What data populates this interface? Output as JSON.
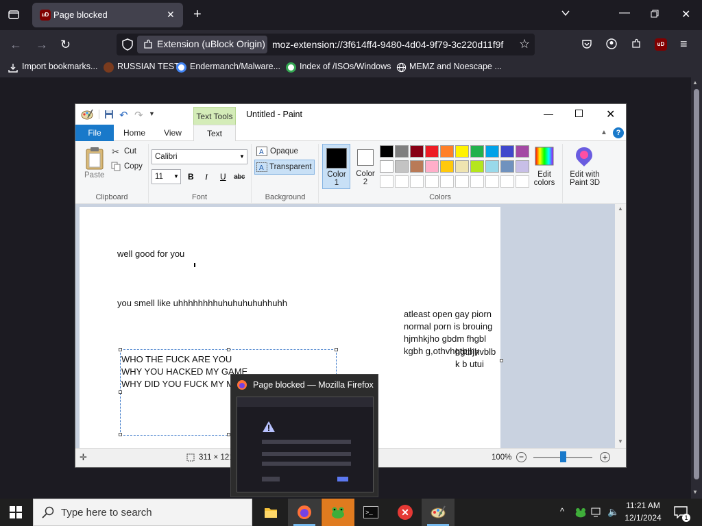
{
  "browser": {
    "tab_title": "Page blocked",
    "tab_favicon_text": "uD",
    "url_chip": "Extension (uBlock Origin)",
    "url": "moz-extension://3f614ff4-9480-4d04-9f79-3c220d11f9f",
    "bookmarks": [
      {
        "label": "Import bookmarks...",
        "icon": "import-icon"
      },
      {
        "label": "RUSSIAN TEST",
        "icon": "russian-test-favicon"
      },
      {
        "label": "Endermanch/Malware...",
        "icon": "google-favicon"
      },
      {
        "label": "Index of /ISOs/Windows",
        "icon": "google-favicon"
      },
      {
        "label": "MEMZ and Noescape ...",
        "icon": "globe-icon"
      }
    ]
  },
  "paint": {
    "title": "Untitled - Paint",
    "contextual_tab": "Text Tools",
    "tabs": {
      "file": "File",
      "home": "Home",
      "view": "View",
      "text": "Text"
    },
    "clipboard": {
      "paste": "Paste",
      "cut": "Cut",
      "copy": "Copy",
      "group": "Clipboard"
    },
    "font": {
      "family": "Calibri",
      "size": "11",
      "bold": "B",
      "italic": "I",
      "underline": "U",
      "strike": "abc",
      "group": "Font"
    },
    "background": {
      "opaque": "Opaque",
      "transparent": "Transparent",
      "group": "Background"
    },
    "colors": {
      "color1": "Color 1",
      "color2": "Color 2",
      "group": "Colors",
      "edit_colors": "Edit colors",
      "edit_paint3d": "Edit with Paint 3D",
      "palette_row1": [
        "#000000",
        "#7f7f7f",
        "#880015",
        "#ed1c24",
        "#ff7f27",
        "#fff200",
        "#22b14c",
        "#00a2e8",
        "#3f48cc",
        "#a349a4"
      ],
      "palette_row2": [
        "#ffffff",
        "#c3c3c3",
        "#b97a57",
        "#ffaec9",
        "#ffc90e",
        "#efe4b0",
        "#b5e61d",
        "#99d9ea",
        "#7092be",
        "#c8bfe7"
      ]
    },
    "canvas_texts": {
      "line1": "well good for you",
      "line2": "you smell like uhhhhhhhhuhuhuhuhuhhuhh",
      "box_lines": [
        "WHO THE FUCK ARE YOU",
        "WHY YOU HACKED MY GAME",
        "WHY DID YOU FUCK MY MO"
      ],
      "right_lines": [
        "atleast open gay piorn",
        "normal porn is brouing",
        "hjmhkjho gbdm fhgbl",
        "kgbh g,othvhgtb,hy"
      ],
      "overlay_lines": [
        "hgtbjhvblb",
        "k b   utui"
      ]
    },
    "status": {
      "size": "311 × 121",
      "zoom": "100%"
    }
  },
  "thumbnail": {
    "title": "Page blocked — Mozilla Firefox"
  },
  "taskbar": {
    "search_placeholder": "Type here to search",
    "time": "11:21 AM",
    "date": "12/1/2024",
    "notification_count": "1"
  }
}
